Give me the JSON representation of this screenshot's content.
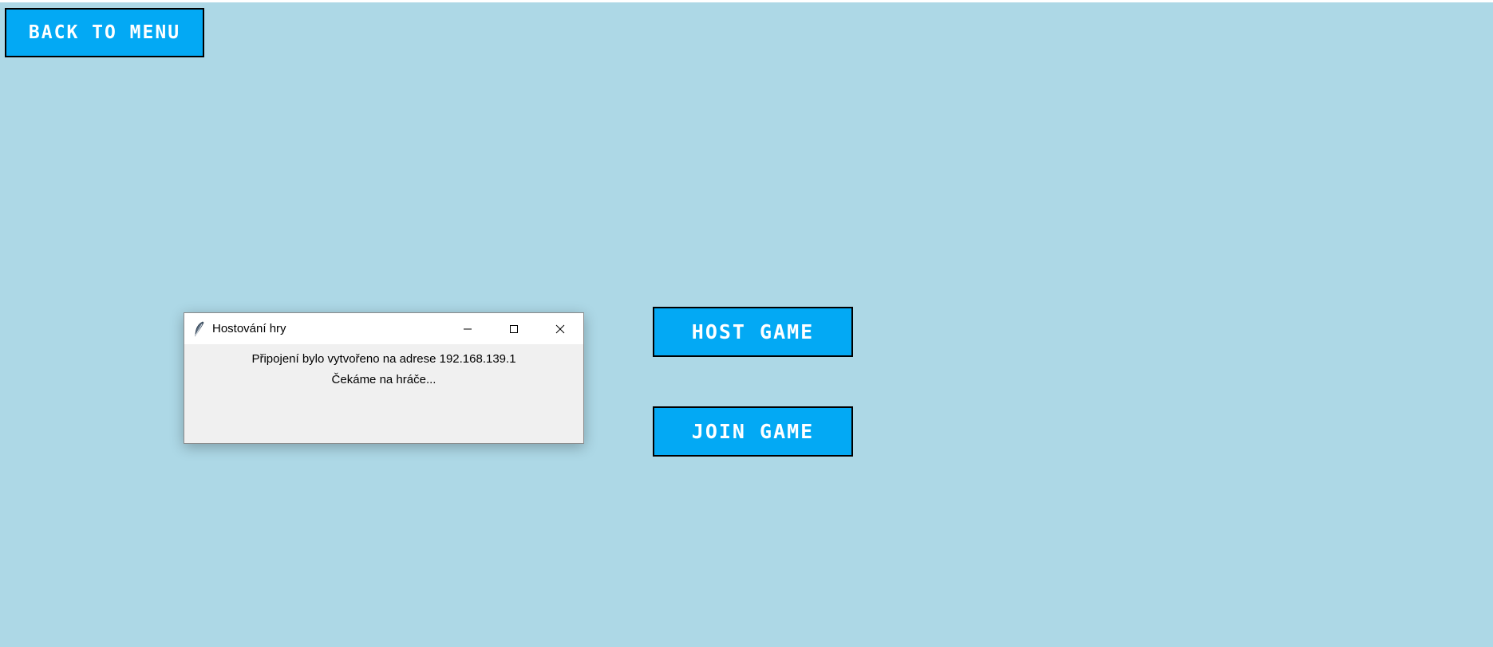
{
  "colors": {
    "background": "#add8e6",
    "button_fill": "#03a9f4",
    "button_border": "#000000",
    "button_text": "#ffffff",
    "dialog_background": "#f0f0f0"
  },
  "nav": {
    "back_label": "BACK TO MENU"
  },
  "menu": {
    "host_label": "HOST GAME",
    "join_label": "JOIN GAME"
  },
  "dialog": {
    "title": "Hostování hry",
    "icon": "feather-icon",
    "controls": [
      "minimize-icon",
      "maximize-icon",
      "close-icon"
    ],
    "message_line1": "Připojení bylo vytvořeno na adrese 192.168.139.1",
    "message_line2": "Čekáme na hráče..."
  }
}
